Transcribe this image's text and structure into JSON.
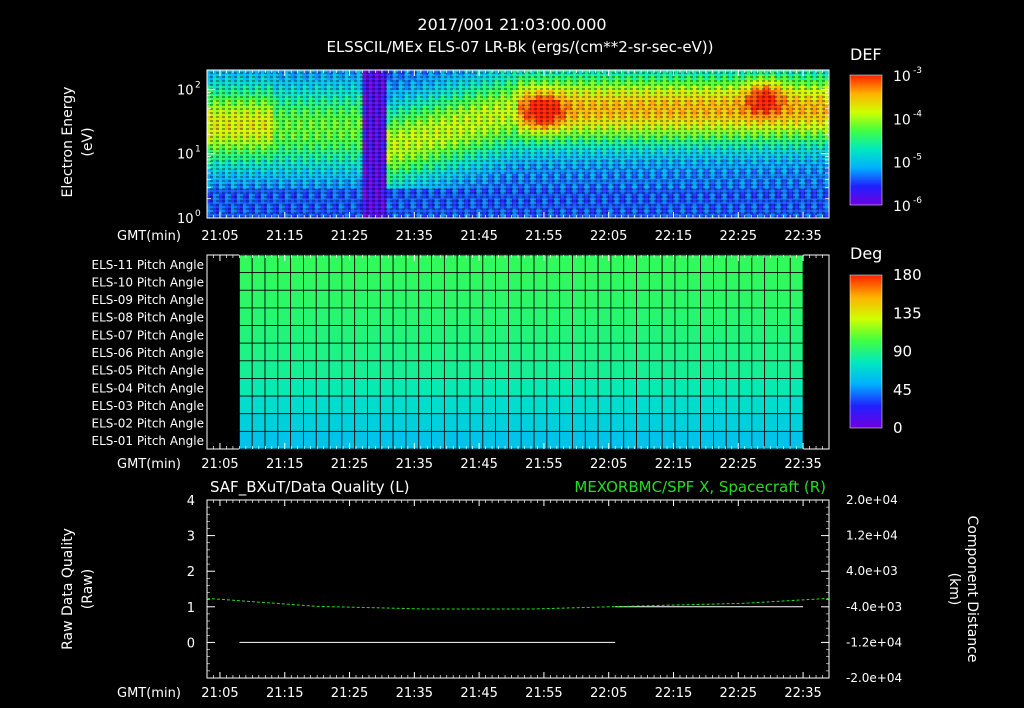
{
  "header": {
    "title": "2017/001 21:03:00.000",
    "subtitle": "ELSSCIL/MEx ELS-07 LR-Bk  (ergs/(cm**2-sr-sec-eV))"
  },
  "time_axis": {
    "label": "GMT(min)",
    "ticks": [
      "21:05",
      "21:15",
      "21:25",
      "21:35",
      "21:45",
      "21:55",
      "22:05",
      "22:15",
      "22:25",
      "22:35"
    ],
    "range_minutes": [
      1263,
      1359
    ],
    "tick_minutes": [
      1265,
      1275,
      1285,
      1295,
      1305,
      1315,
      1325,
      1335,
      1345,
      1355
    ]
  },
  "colors": {
    "scale_stops": [
      "#7000e0",
      "#2020ff",
      "#00b0ff",
      "#00e8c0",
      "#40ff40",
      "#d0ff00",
      "#ffb000",
      "#ff2000"
    ],
    "series_left": "#ffffff",
    "series_right": "#22dd22"
  },
  "chart_data": [
    {
      "type": "heatmap",
      "name_id": "energy-spectrogram",
      "ylabel": "Electron Energy",
      "yunit": "(eV)",
      "yscale": "log",
      "ylim": [
        1,
        200
      ],
      "yticks": [
        {
          "value": 1,
          "base": "10",
          "exp": "0"
        },
        {
          "value": 10,
          "base": "10",
          "exp": "1"
        },
        {
          "value": 100,
          "base": "10",
          "exp": "2"
        }
      ],
      "colorbar": {
        "title": "DEF",
        "scale": "log",
        "range": [
          1e-06,
          0.001
        ],
        "labels": [
          {
            "base": "10",
            "exp": "-3"
          },
          {
            "base": "10",
            "exp": "-4"
          },
          {
            "base": "10",
            "exp": "-5"
          },
          {
            "base": "10",
            "exp": "-6"
          }
        ]
      }
    },
    {
      "type": "heatmap",
      "name_id": "pitch-angle-grid",
      "row_labels": [
        "ELS-11 Pitch Angle",
        "ELS-10 Pitch Angle",
        "ELS-09 Pitch Angle",
        "ELS-08 Pitch Angle",
        "ELS-07 Pitch Angle",
        "ELS-06 Pitch Angle",
        "ELS-05 Pitch Angle",
        "ELS-04 Pitch Angle",
        "ELS-03 Pitch Angle",
        "ELS-02 Pitch Angle",
        "ELS-01 Pitch Angle"
      ],
      "row_values_deg": [
        97,
        96,
        95,
        93,
        91,
        89,
        86,
        80,
        72,
        66,
        60
      ],
      "data_time_range_minutes": [
        1268,
        1355
      ],
      "columns": 44,
      "colorbar": {
        "title": "Deg",
        "range": [
          0,
          180
        ],
        "labels": [
          "180",
          "135",
          "90",
          "45",
          "0"
        ]
      }
    },
    {
      "type": "line",
      "name_id": "quality-and-distance",
      "title_left": "SAF_BXuT/Data Quality (L)",
      "title_right": "MEXORBMC/SPF X, Spacecraft (R)",
      "ylabel_left": "Raw Data Quality",
      "yunit_left": "(Raw)",
      "ylim_left": [
        -1,
        4
      ],
      "yticks_left": [
        "-1",
        "0",
        "1",
        "2",
        "3",
        "4"
      ],
      "ylabel_right": "Component Distance",
      "yunit_right": "(km)",
      "ylim_right": [
        -20000,
        20000
      ],
      "yticks_right": [
        "-2.0e+04",
        "-1.2e+04",
        "-4.0e+03",
        "4.0e+03",
        "1.2e+04",
        "2.0e+04"
      ],
      "series": [
        {
          "axis": "left",
          "segments": [
            {
              "x": [
                1268,
                1326
              ],
              "y": [
                0,
                0
              ]
            },
            {
              "x": [
                1326,
                1355
              ],
              "y": [
                1,
                1
              ]
            }
          ]
        },
        {
          "axis": "right",
          "x": [
            1263,
            1280,
            1297,
            1313,
            1330,
            1346,
            1359
          ],
          "y": [
            -2100,
            -3900,
            -4500,
            -4500,
            -3800,
            -3200,
            -2100
          ]
        }
      ]
    }
  ]
}
